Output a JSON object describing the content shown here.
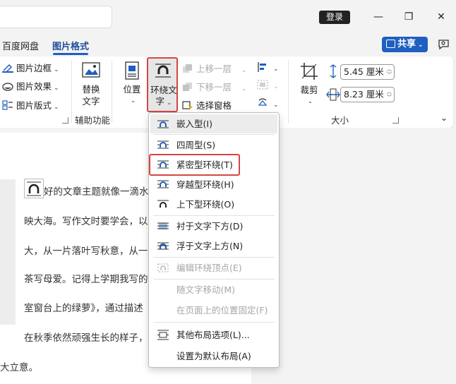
{
  "titlebar": {
    "login_label": "登录",
    "minimize_glyph": "—",
    "maximize_glyph": "❐",
    "close_glyph": "✕"
  },
  "tabs": {
    "items": [
      {
        "label": "百度网盘"
      },
      {
        "label": "图片格式"
      }
    ],
    "share_label": "共享"
  },
  "ribbon": {
    "picture_border": "图片边框",
    "picture_effects": "图片效果",
    "picture_layout": "图片版式",
    "alt_text_line1": "替换",
    "alt_text_line2": "文字",
    "accessibility_group": "辅助功能",
    "position_label": "位置",
    "wrap_text_line1": "环绕文",
    "wrap_text_line2": "字",
    "bring_forward": "上移一层",
    "send_backward": "下移一层",
    "selection_pane": "选择窗格",
    "crop_label": "裁剪",
    "size_group": "大小",
    "height_value": "5.45 厘米",
    "width_value": "8.23 厘米"
  },
  "document": {
    "lines": [
      "好的文章主题就像一滴水",
      "映大海。写作文时要学会，以",
      "大，从一片落叶写秋意，从一",
      "茶写母爱。记得上学期我写的",
      "室窗台上的绿萝》，通过描述",
      "在秋季依然顽强生长的样子，",
      "大立意。"
    ]
  },
  "wrap_menu": {
    "items": [
      {
        "label": "嵌入型(I)"
      },
      {
        "label": "四周型(S)"
      },
      {
        "label": "紧密型环绕(T)"
      },
      {
        "label": "穿越型环绕(H)"
      },
      {
        "label": "上下型环绕(O)"
      },
      {
        "label": "衬于文字下方(D)"
      },
      {
        "label": "浮于文字上方(N)"
      },
      {
        "label": "编辑环绕顶点(E)"
      },
      {
        "label": "随文字移动(M)"
      },
      {
        "label": "在页面上的位置固定(F)"
      },
      {
        "label": "其他布局选项(L)..."
      },
      {
        "label": "设置为默认布局(A)"
      }
    ]
  },
  "colors": {
    "accent": "#1f5fbf",
    "highlight_border": "#d64545"
  }
}
